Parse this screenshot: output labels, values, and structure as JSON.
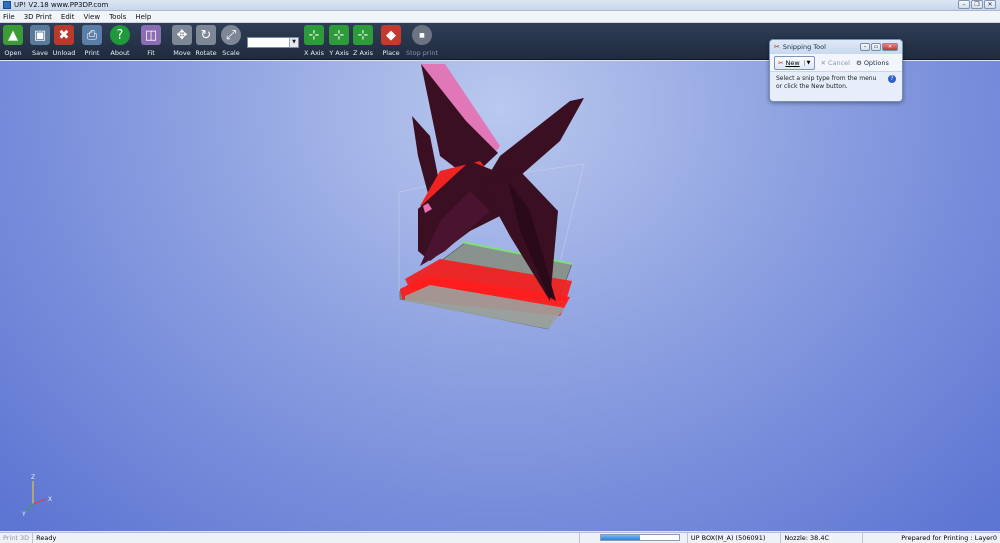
{
  "window": {
    "title": "UP!  V2.18 www.PP3DP.com",
    "controls": [
      "–",
      "❐",
      "✕"
    ]
  },
  "menu": [
    "File",
    "3D Print",
    "Edit",
    "View",
    "Tools",
    "Help"
  ],
  "toolbar": {
    "buttons": [
      {
        "label": "Open",
        "icon": "open-icon",
        "color": "#3d9b35"
      },
      {
        "label": "Save",
        "icon": "save-icon",
        "color": "#5b7a9a"
      },
      {
        "label": "Unload",
        "icon": "unload-icon",
        "color": "#b83a2d"
      },
      {
        "label": "Print",
        "icon": "print-icon",
        "color": "#5a7ea8"
      },
      {
        "label": "About",
        "icon": "about-icon",
        "color": "#1f9a3a"
      },
      {
        "label": "Fit",
        "icon": "fit-icon",
        "color": "#8a6db3"
      },
      {
        "label": "Move",
        "icon": "move-icon",
        "color": "#7d8796"
      },
      {
        "label": "Rotate",
        "icon": "rotate-icon",
        "color": "#7d8796"
      },
      {
        "label": "Scale",
        "icon": "scale-icon",
        "color": "#7d8796"
      },
      {
        "label": "X Axis",
        "icon": "x-axis-icon",
        "color": "#2d9b3a"
      },
      {
        "label": "Y Axis",
        "icon": "y-axis-icon",
        "color": "#2d9b3a"
      },
      {
        "label": "Z Axis",
        "icon": "z-axis-icon",
        "color": "#2d9b3a"
      },
      {
        "label": "Place",
        "icon": "place-icon",
        "color": "#c43b2e"
      },
      {
        "label": "Stop print",
        "icon": "stop-icon",
        "color": "#6c7482"
      }
    ],
    "scale_value": ""
  },
  "snipping_tool": {
    "title": "Snipping Tool",
    "new_label": "New",
    "cancel_label": "Cancel",
    "options_label": "Options",
    "message_line1": "Select a snip type from the menu",
    "message_line2": "or click the New button."
  },
  "viewport": {
    "axis_labels": [
      "X",
      "Y",
      "Z"
    ],
    "colors": {
      "model": "#3a0f22",
      "model_highlight": "#e66fb0",
      "support": "#ff2a2a",
      "platform": "#7c8a86",
      "grid": "#7ee07a"
    }
  },
  "status": {
    "mode": "Print 3D",
    "state": "Ready",
    "progress": 0.5,
    "printer": "UP BOX(M_A) (506091)",
    "nozzle": "Nozzle: 38.4C",
    "print_state": "Prepared for Printing : Layer0"
  }
}
